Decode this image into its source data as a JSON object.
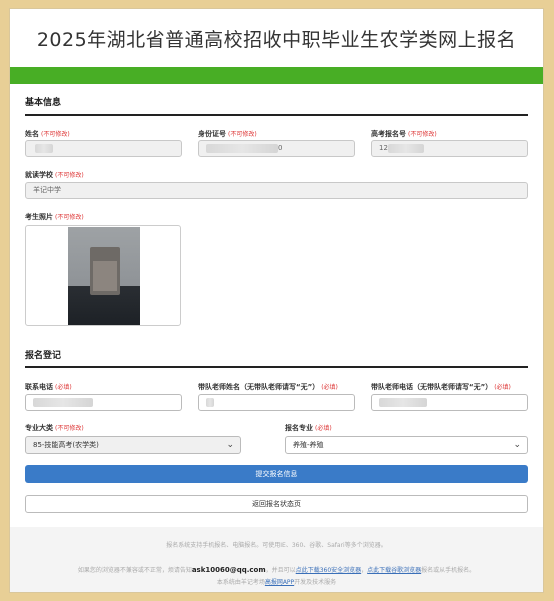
{
  "page": {
    "title": "2025年湖北省普通高校招收中职毕业生农学类网上报名",
    "brand_green": "#48ae25",
    "primary_blue": "#3a7bc8"
  },
  "basic_info": {
    "section_title": "基本信息",
    "name": {
      "label": "姓名",
      "tag": "(不可修改)"
    },
    "id_number": {
      "label": "身份证号",
      "tag": "(不可修改)",
      "visible_tail": "0"
    },
    "exam_number": {
      "label": "高考报名号",
      "tag": "(不可修改)",
      "visible_head": "12"
    },
    "school": {
      "label": "就读学校",
      "tag": "(不可修改)",
      "value": "羊记中学"
    },
    "photo": {
      "label": "考生照片",
      "tag": "(不可修改)"
    }
  },
  "registration": {
    "section_title": "报名登记",
    "phone": {
      "label": "联系电话",
      "tag": "(必填)"
    },
    "teacher_name": {
      "label": "带队老师姓名（无带队老师请写“无”）",
      "tag": "(必填)"
    },
    "teacher_phone": {
      "label": "带队老师电话（无带队老师请写“无”）",
      "tag": "(必填)"
    },
    "major_category": {
      "label": "专业大类",
      "tag": "(不可修改)",
      "value": "85-技能高考(农学类)"
    },
    "major": {
      "label": "报名专业",
      "tag": "(必填)",
      "value": "养殖-养殖"
    },
    "submit_label": "提交报名信息",
    "back_label": "返回报名状态页"
  },
  "footer": {
    "line1": "报名系统支持手机报名、电脑报名。可使用IE、360、谷歌、Safari等多个浏览器。",
    "line2_prefix": "如果您的浏览器不兼容或不正常，烦请告知",
    "email": "ask10060@qq.com",
    "line2_mid": "，并且可以",
    "link_360": "点此下载360安全浏览器",
    "link_sep": "，",
    "link_chrome": "点此下载谷歌浏览器",
    "line2_suffix": "报名或从手机报名。",
    "line3_prefix": "本系统由羊记考场",
    "line3_link": "高报网APP",
    "line3_suffix": "开发及技术服务"
  }
}
